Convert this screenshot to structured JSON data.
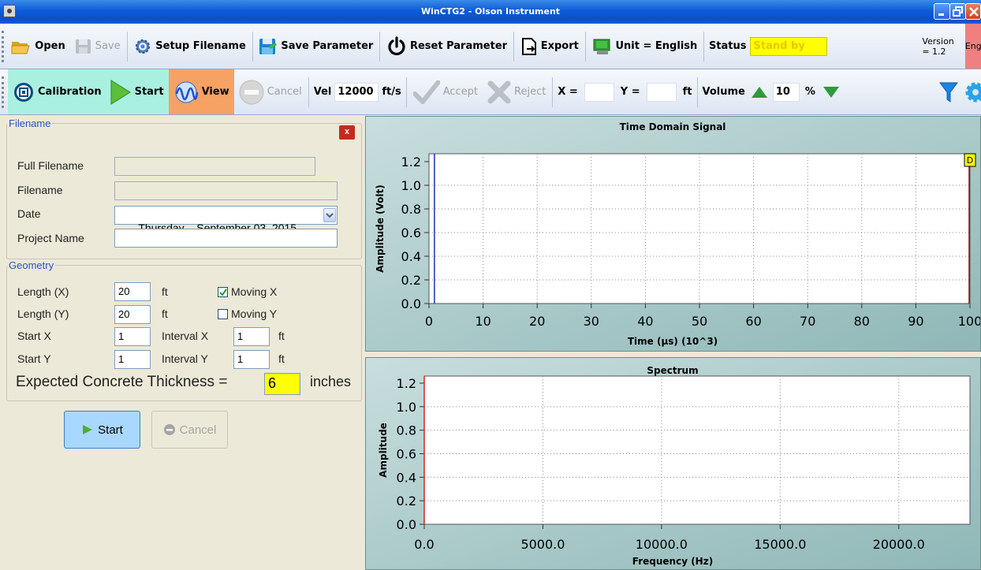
{
  "window": {
    "title": "WinCTG2 - Olson Instrument"
  },
  "toolbar1": {
    "open": "Open",
    "save": "Save",
    "setup_filename": "Setup Filename",
    "save_parameter": "Save Parameter",
    "reset_parameter": "Reset Parameter",
    "export": "Export",
    "unit": "Unit = English",
    "status_label": "Status",
    "status_value": "Stand by",
    "version": "Version = 1.2",
    "language": "English"
  },
  "toolbar2": {
    "calibration": "Calibration",
    "start": "Start",
    "view": "View",
    "cancel": "Cancel",
    "vel_label": "Vel",
    "vel_value": "12000",
    "vel_unit": "ft/s",
    "accept": "Accept",
    "reject": "Reject",
    "x_label": "X =",
    "x_value": "",
    "y_label": "Y =",
    "y_value": "",
    "xy_unit": "ft",
    "volume_label": "Volume",
    "volume_value": "10",
    "volume_unit": "%"
  },
  "filename_group": {
    "legend": "Filename",
    "close": "x",
    "full_filename_label": "Full Filename",
    "full_filename_value": "",
    "filename_label": "Filename",
    "filename_value": "",
    "date_label": "Date",
    "date_value": "Thursday  , September 03, 2015",
    "project_name_label": "Project Name",
    "project_name_value": ""
  },
  "geometry_group": {
    "legend": "Geometry",
    "length_x_label": "Length (X)",
    "length_x_value": "20",
    "length_x_unit": "ft",
    "length_y_label": "Length (Y)",
    "length_y_value": "20",
    "length_y_unit": "ft",
    "moving_x_label": "Moving X",
    "moving_x_checked": true,
    "moving_y_label": "Moving Y",
    "moving_y_checked": false,
    "start_x_label": "Start X",
    "start_x_value": "1",
    "interval_x_label": "Interval X",
    "interval_x_value": "1",
    "interval_x_unit": "ft",
    "start_y_label": "Start Y",
    "start_y_value": "1",
    "interval_y_label": "Interval Y",
    "interval_y_value": "1",
    "interval_y_unit": "ft",
    "thickness_label": "Expected Concrete Thickness =",
    "thickness_value": "6",
    "thickness_unit": "inches"
  },
  "actions": {
    "start": "Start",
    "cancel": "Cancel"
  },
  "colors": {
    "status_bg": "#ffff00",
    "status_text": "#e8c800",
    "start_btn": "#a8d8ff",
    "calibration_bg": "#a9f0e0",
    "view_bg": "#f6a265",
    "language_bg": "#f08080"
  },
  "chart_data": [
    {
      "type": "line",
      "title": "Time Domain Signal",
      "xlabel": "Time (μs) (10^3)",
      "ylabel": "Amplitude (Volt)",
      "xlim": [
        0,
        100
      ],
      "ylim": [
        0,
        1.2
      ],
      "x_ticks": [
        "0",
        "10",
        "20",
        "30",
        "40",
        "50",
        "60",
        "70",
        "80",
        "90",
        "100"
      ],
      "y_ticks": [
        "0.0",
        "0.2",
        "0.4",
        "0.6",
        "0.8",
        "1.0",
        "1.2"
      ],
      "grid": true,
      "markers": [
        {
          "x": 1,
          "color": "#2030c0"
        },
        {
          "x": 100,
          "color": "#8b1010"
        }
      ],
      "badge": "D"
    },
    {
      "type": "line",
      "title": "Spectrum",
      "xlabel": "Frequency (Hz)",
      "ylabel": "Amplitude",
      "xlim": [
        0,
        23000
      ],
      "ylim": [
        0,
        1.2
      ],
      "x_tick_values": [
        0,
        5000,
        10000,
        15000,
        20000
      ],
      "x_ticks": [
        "0.0",
        "5000.0",
        "10000.0",
        "15000.0",
        "20000.0"
      ],
      "y_ticks": [
        "0.0",
        "0.2",
        "0.4",
        "0.6",
        "0.8",
        "1.0",
        "1.2"
      ],
      "grid": true,
      "markers": [
        {
          "x": 0,
          "color": "#e02020"
        }
      ]
    }
  ]
}
